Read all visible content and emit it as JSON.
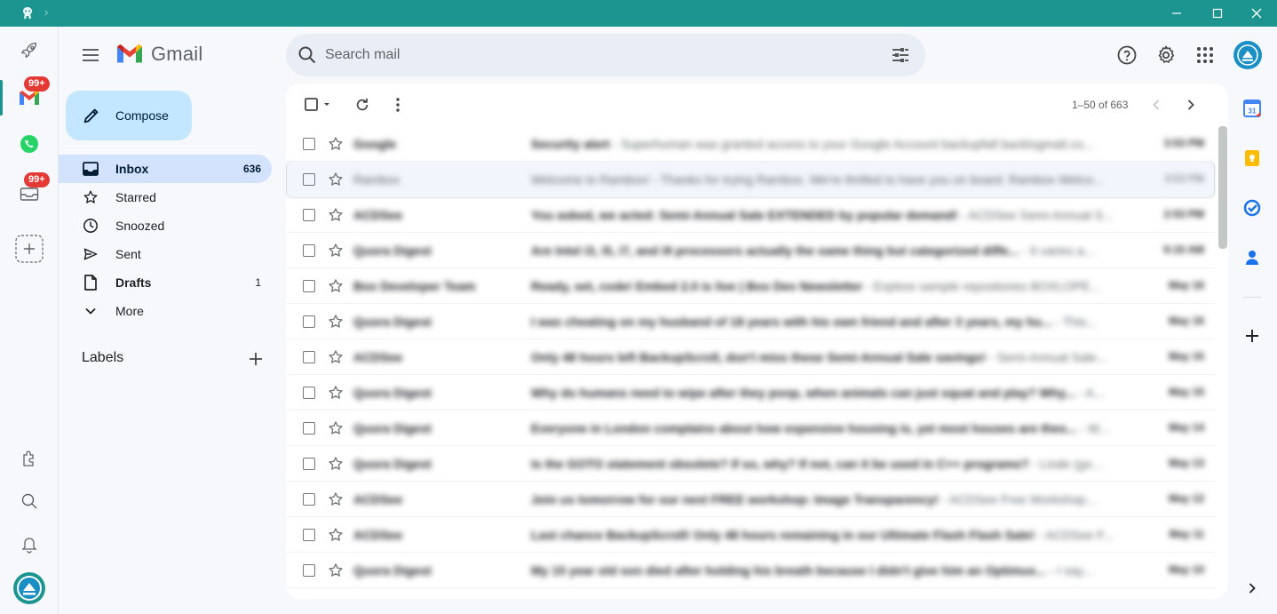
{
  "window": {
    "accent": "#1c9591",
    "controls": [
      "minimize-icon",
      "maximize-icon",
      "close-icon"
    ]
  },
  "dock": {
    "items": [
      {
        "name": "rocket-icon"
      },
      {
        "name": "gmail-icon",
        "badge": "99+"
      },
      {
        "name": "whatsapp-icon"
      },
      {
        "name": "inbox-tray-icon",
        "badge": "99+"
      },
      {
        "name": "add-service-icon"
      }
    ],
    "bottom": [
      "extensions-icon",
      "search-icon",
      "bell-icon",
      "rambox-icon"
    ]
  },
  "header": {
    "logo_text": "Gmail",
    "search_placeholder": "Search mail"
  },
  "compose_label": "Compose",
  "nav": [
    {
      "label": "Inbox",
      "count": "636",
      "icon": "inbox-icon"
    },
    {
      "label": "Starred",
      "count": "",
      "icon": "star-icon"
    },
    {
      "label": "Snoozed",
      "count": "",
      "icon": "clock-icon"
    },
    {
      "label": "Sent",
      "count": "",
      "icon": "send-icon"
    },
    {
      "label": "Drafts",
      "count": "1",
      "icon": "draft-icon"
    },
    {
      "label": "More",
      "count": "",
      "icon": "chevron-down-icon"
    }
  ],
  "labels_title": "Labels",
  "toolbar": {
    "pager": "1–50 of 663"
  },
  "emails": [
    {
      "sender": "Google",
      "subject": "Security alert",
      "snippet": " - Superhuman was granted access to your Google Account backupfall backlogmail.co...",
      "date": "3:53 PM",
      "read": false
    },
    {
      "sender": "Rambox",
      "subject": "Welcome to Rambox!",
      "snippet": " - Thanks for trying Rambox. We're thrilled to have you on board. Rambox Welco...",
      "date": "3:53 PM",
      "read": true
    },
    {
      "sender": "ACDSee",
      "subject": "You asked, we acted: Semi-Annual Sale EXTENDED by popular demand!",
      "snippet": " - ACDSee Semi-Annual S...",
      "date": "2:53 PM",
      "read": false
    },
    {
      "sender": "Quora Digest",
      "subject": "Are Intel i3, i5, i7, and i9 processors actually the same thing but categorized diffe...",
      "snippet": " - It varies a...",
      "date": "9:15 AM",
      "read": false
    },
    {
      "sender": "Box Developer Team",
      "subject": "Ready, set, code! Embed 2.0 is live | Box Dev Newsletter",
      "snippet": " - Explore sample repositories BOXLOPE...",
      "date": "May 16",
      "read": false
    },
    {
      "sender": "Quora Digest",
      "subject": "I was cheating on my husband of 18 years with his own friend and after 3 years, my hu...",
      "snippet": " - This...",
      "date": "May 16",
      "read": false
    },
    {
      "sender": "ACDSee",
      "subject": "Only 48 hours left BackupScroll, don't miss these Semi-Annual Sale savings!",
      "snippet": " - Semi-Annual Sale...",
      "date": "May 15",
      "read": false
    },
    {
      "sender": "Quora Digest",
      "subject": "Why do humans need to wipe after they poop, when animals can just squat and play? Why...",
      "snippet": " - A...",
      "date": "May 15",
      "read": false
    },
    {
      "sender": "Quora Digest",
      "subject": "Everyone in London complains about how expensive housing is, yet most houses are thes...",
      "snippet": " - W...",
      "date": "May 14",
      "read": false
    },
    {
      "sender": "Quora Digest",
      "subject": "Is the GOTO statement obsolete? If so, why? If not, can it be used in C++ programs?",
      "snippet": " - Linde (go...",
      "date": "May 13",
      "read": false
    },
    {
      "sender": "ACDSee",
      "subject": "Join us tomorrow for our next FREE workshop: Image Transparency!",
      "snippet": " - ACDSee Free Workshop...",
      "date": "May 12",
      "read": false
    },
    {
      "sender": "ACDSee",
      "subject": "Last chance BackupScroll! Only 48 hours remaining in our Ultimate Flash Flash Sale!",
      "snippet": " - ACDSee F...",
      "date": "May 11",
      "read": false
    },
    {
      "sender": "Quora Digest",
      "subject": "My 15 year old son died after holding his breath because I didn't give him an Optimus...",
      "snippet": " - I say...",
      "date": "May 10",
      "read": false
    }
  ],
  "right_panel": [
    "calendar-icon",
    "keep-icon",
    "tasks-icon",
    "contacts-icon",
    "add-addon-icon",
    "expand-chevron-icon"
  ]
}
